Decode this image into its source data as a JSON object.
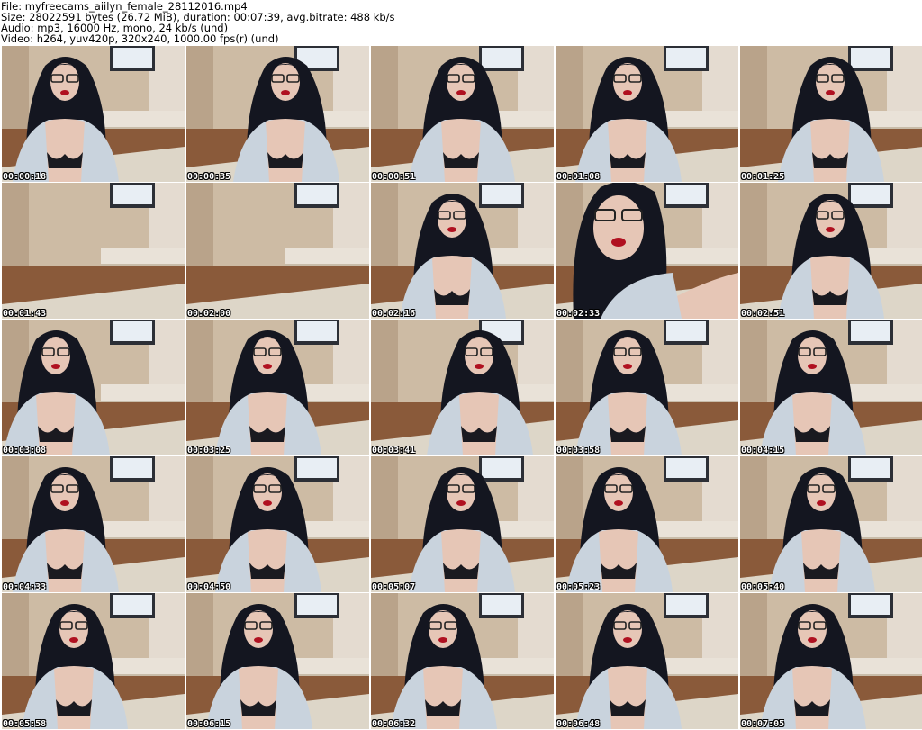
{
  "header": {
    "file": "File: myfreecams_aiilyn_female_28112016.mp4",
    "size": "Size: 28022591 bytes (26.72 MiB), duration: 00:07:39, avg.bitrate: 488 kb/s",
    "audio": "Audio: mp3, 16000 Hz, mono, 24 kb/s (und)",
    "video": "Video: h264, yuv420p, 320x240, 1000.00 fps(r) (und)"
  },
  "thumbnails": [
    {
      "time": "00:00:18",
      "scene": "person"
    },
    {
      "time": "00:00:35",
      "scene": "person"
    },
    {
      "time": "00:00:51",
      "scene": "person"
    },
    {
      "time": "00:01:08",
      "scene": "person"
    },
    {
      "time": "00:01:25",
      "scene": "person"
    },
    {
      "time": "00:01:43",
      "scene": "room"
    },
    {
      "time": "00:02:00",
      "scene": "room"
    },
    {
      "time": "00:02:16",
      "scene": "person"
    },
    {
      "time": "00:02:33",
      "scene": "closeup"
    },
    {
      "time": "00:02:51",
      "scene": "person"
    },
    {
      "time": "00:03:08",
      "scene": "person"
    },
    {
      "time": "00:03:25",
      "scene": "person"
    },
    {
      "time": "00:03:41",
      "scene": "person"
    },
    {
      "time": "00:03:58",
      "scene": "person"
    },
    {
      "time": "00:04:15",
      "scene": "person"
    },
    {
      "time": "00:04:33",
      "scene": "person"
    },
    {
      "time": "00:04:50",
      "scene": "person"
    },
    {
      "time": "00:05:07",
      "scene": "person"
    },
    {
      "time": "00:05:23",
      "scene": "person"
    },
    {
      "time": "00:05:40",
      "scene": "person"
    },
    {
      "time": "00:05:58",
      "scene": "person"
    },
    {
      "time": "00:06:15",
      "scene": "person"
    },
    {
      "time": "00:06:32",
      "scene": "person"
    },
    {
      "time": "00:06:48",
      "scene": "person"
    },
    {
      "time": "00:07:05",
      "scene": "person"
    }
  ],
  "colors": {
    "wall": "#cdbba4",
    "floor": "#8a5a3a",
    "rug": "#ddd6c8",
    "tv_screen": "#e8eef4",
    "shirt": "#c9d3dd",
    "hair": "#141620",
    "skin": "#e6c6b6",
    "lips": "#b01020",
    "bra": "#1a1a20"
  }
}
